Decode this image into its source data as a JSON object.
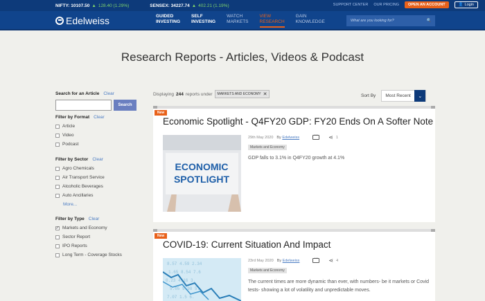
{
  "ticker": {
    "nifty_label": "NIFTY: 10107.50",
    "nifty_change": "128.40 (1.29%)",
    "sensex_label": "SENSEX: 34227.74",
    "sensex_change": "402.21 (1.19%)",
    "support": "SUPPORT CENTER",
    "pricing": "OUR PRICING",
    "open_account": "OPEN AN ACCOUNT",
    "login": "Login"
  },
  "nav": {
    "brand": "Edelweiss",
    "items": [
      {
        "line1": "GUIDED",
        "line2": "INVESTING"
      },
      {
        "line1": "SELF",
        "line2": "INVESTING"
      },
      {
        "line1": "WATCH",
        "line2": "MARKETS"
      },
      {
        "line1": "VIEW",
        "line2": "RESEARCH"
      },
      {
        "line1": "GAIN",
        "line2": "KNOWLEDGE"
      }
    ],
    "search_placeholder": "What are you looking for?"
  },
  "page": {
    "title": "Research Reports - Articles, Videos & Podcast"
  },
  "sidebar": {
    "search_title": "Search for an Article",
    "clear": "Clear",
    "search_button": "Search",
    "format_title": "Filter by Format",
    "formats": [
      "Article",
      "Video",
      "Podcast"
    ],
    "sector_title": "Filter by Sector",
    "sectors": [
      "Agro Chemicals",
      "Air Transport Service",
      "Alcoholic Beverages",
      "Auto Ancillaries"
    ],
    "more": "More...",
    "type_title": "Filter by Type",
    "types": [
      "Markets and Economy",
      "Sector Report",
      "IPO Reports",
      "Long Term - Coverage Stocks"
    ]
  },
  "results": {
    "prefix": "Displaying",
    "count": "244",
    "suffix": "reports under",
    "tag": "MARKETS AND ECONOMY",
    "sort_label": "Sort By",
    "sort_value": "Most Recent"
  },
  "articles": [
    {
      "badge": "New",
      "title": "Economic Spotlight - Q4FY20 GDP: FY20 Ends On A Softer Note",
      "thumb_text_1": "ECONOMIC",
      "thumb_text_2": "SPOTLIGHT",
      "date": "29th May 2020",
      "by": "By",
      "author": "Edelweiss",
      "shares": "1",
      "category": "Markets and Economy",
      "summary": "GDP falls to 3.1% in Q4FY20 growth at 4.1%"
    },
    {
      "badge": "New",
      "title": "COVID-19: Current Situation And Impact",
      "date": "23rd May 2020",
      "by": "By",
      "author": "Edelweiss",
      "shares": "4",
      "category": "Markets and Economy",
      "summary": "The current times are more dynamic than ever, with numbers- be it markets or Covid tests- showing a lot of volatility and unpredictable moves."
    }
  ],
  "colors": {
    "brand_blue": "#10448c",
    "accent_orange": "#e8611a",
    "link_blue": "#4a7bc2"
  }
}
